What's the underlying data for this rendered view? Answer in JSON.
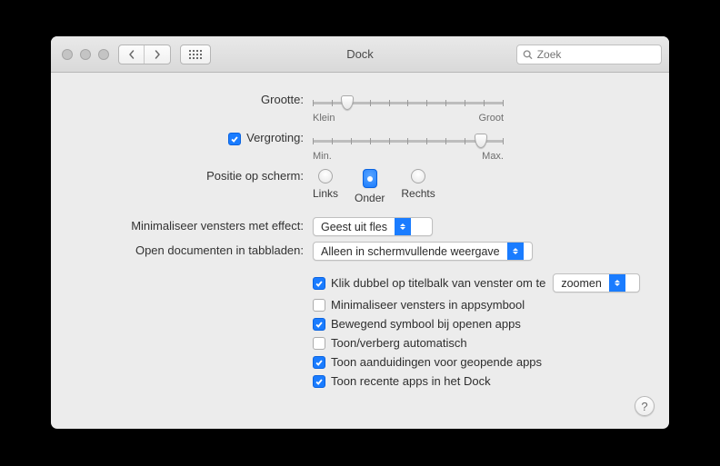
{
  "window": {
    "title": "Dock"
  },
  "toolbar": {
    "search_placeholder": "Zoek"
  },
  "rows": {
    "size": {
      "label": "Grootte:",
      "min": "Klein",
      "max": "Groot",
      "value_pct": 18
    },
    "magnification": {
      "label": "Vergroting:",
      "checked": true,
      "min": "Min.",
      "max": "Max.",
      "value_pct": 88
    },
    "position": {
      "label": "Positie op scherm:",
      "options": {
        "left": "Links",
        "bottom": "Onder",
        "right": "Rechts"
      },
      "selected": "bottom"
    },
    "minimize_effect": {
      "label": "Minimaliseer vensters met effect:",
      "value": "Geest uit fles"
    },
    "open_in_tabs": {
      "label": "Open documenten in tabbladen:",
      "value": "Alleen in schermvullende weergave"
    }
  },
  "checks": {
    "double_click": {
      "checked": true,
      "label": "Klik dubbel op titelbalk van venster om te",
      "action_value": "zoomen"
    },
    "minimize_into_icon": {
      "checked": false,
      "label": "Minimaliseer vensters in appsymbool"
    },
    "animate_open": {
      "checked": true,
      "label": "Bewegend symbool bij openen apps"
    },
    "autohide": {
      "checked": false,
      "label": "Toon/verberg automatisch"
    },
    "indicators": {
      "checked": true,
      "label": "Toon aanduidingen voor geopende apps"
    },
    "recent_apps": {
      "checked": true,
      "label": "Toon recente apps in het Dock"
    }
  },
  "help_label": "?"
}
